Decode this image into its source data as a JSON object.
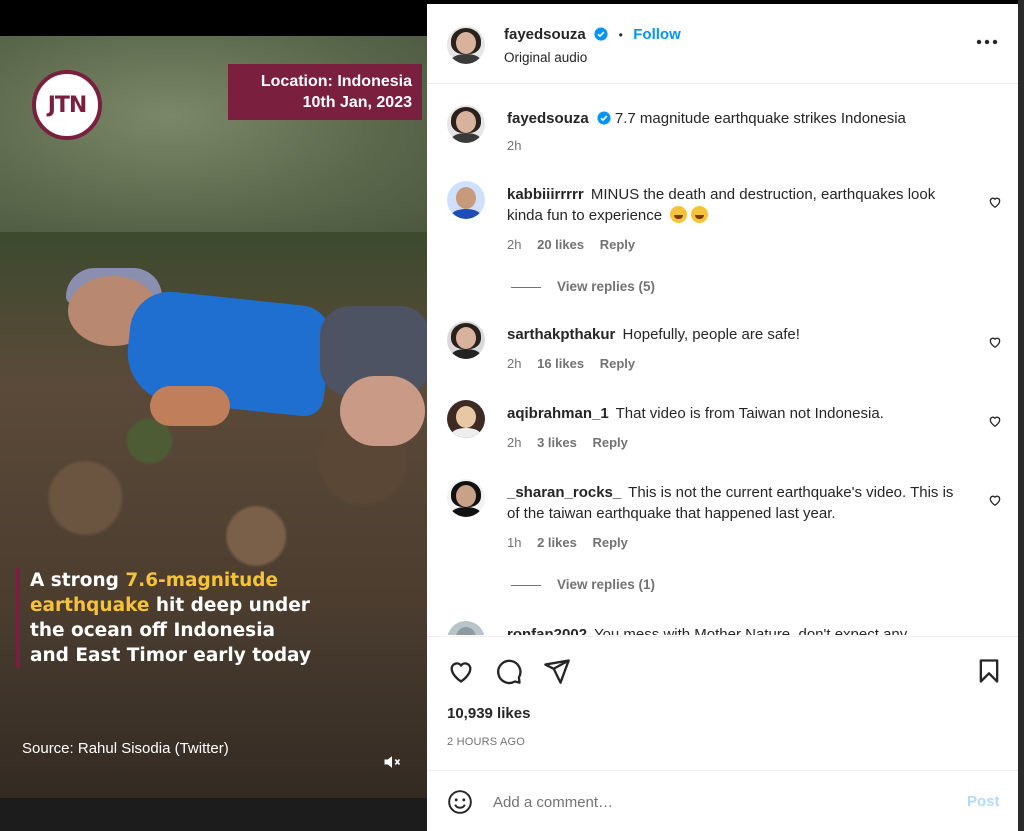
{
  "video": {
    "logo_text": "JTN",
    "location_line1": "Location: Indonesia",
    "location_line2": "10th Jan, 2023",
    "headline_part1": "A strong ",
    "headline_highlight": "7.6-magnitude earthquake",
    "headline_part2": " hit deep under the ocean off Indonesia and East Timor early today",
    "source": "Source: Rahul Sisodia (Twitter)",
    "accent_color": "#7a1f3d",
    "highlight_color": "#f5c338"
  },
  "post": {
    "author": "fayedsouza",
    "follow_label": "Follow",
    "audio": "Original audio",
    "caption_author": "fayedsouza",
    "caption_text": "7.7 magnitude earthquake strikes Indonesia",
    "caption_time": "2h"
  },
  "comments": [
    {
      "user": "kabbiiirrrrr",
      "text": "MINUS the death and destruction, earthquakes look kinda fun to experience",
      "time": "2h",
      "likes": "20 likes",
      "reply": "Reply",
      "view_replies": "View replies (5)"
    },
    {
      "user": "sarthakpthakur",
      "text": "Hopefully, people are safe!",
      "time": "2h",
      "likes": "16 likes",
      "reply": "Reply"
    },
    {
      "user": "aqibrahman_1",
      "text": "That video is from Taiwan not Indonesia.",
      "time": "2h",
      "likes": "3 likes",
      "reply": "Reply"
    },
    {
      "user": "_sharan_rocks_",
      "text": "This is not the current earthquake's video. This is of the taiwan earthquake that happened last year.",
      "time": "1h",
      "likes": "2 likes",
      "reply": "Reply",
      "view_replies": "View replies (1)"
    },
    {
      "user": "ronfan2002",
      "text": "You mess with Mother Nature, don't expect any"
    }
  ],
  "actions": {
    "likes": "10,939 likes",
    "time_ago": "2 HOURS AGO",
    "comment_placeholder": "Add a comment…",
    "post_label": "Post",
    "icons": [
      "heart-icon",
      "comment-icon",
      "share-icon",
      "bookmark-icon",
      "emoji-icon"
    ]
  },
  "colors": {
    "link_blue": "#0095f6",
    "post_disabled": "#b3dbff",
    "muted": "#737373"
  }
}
